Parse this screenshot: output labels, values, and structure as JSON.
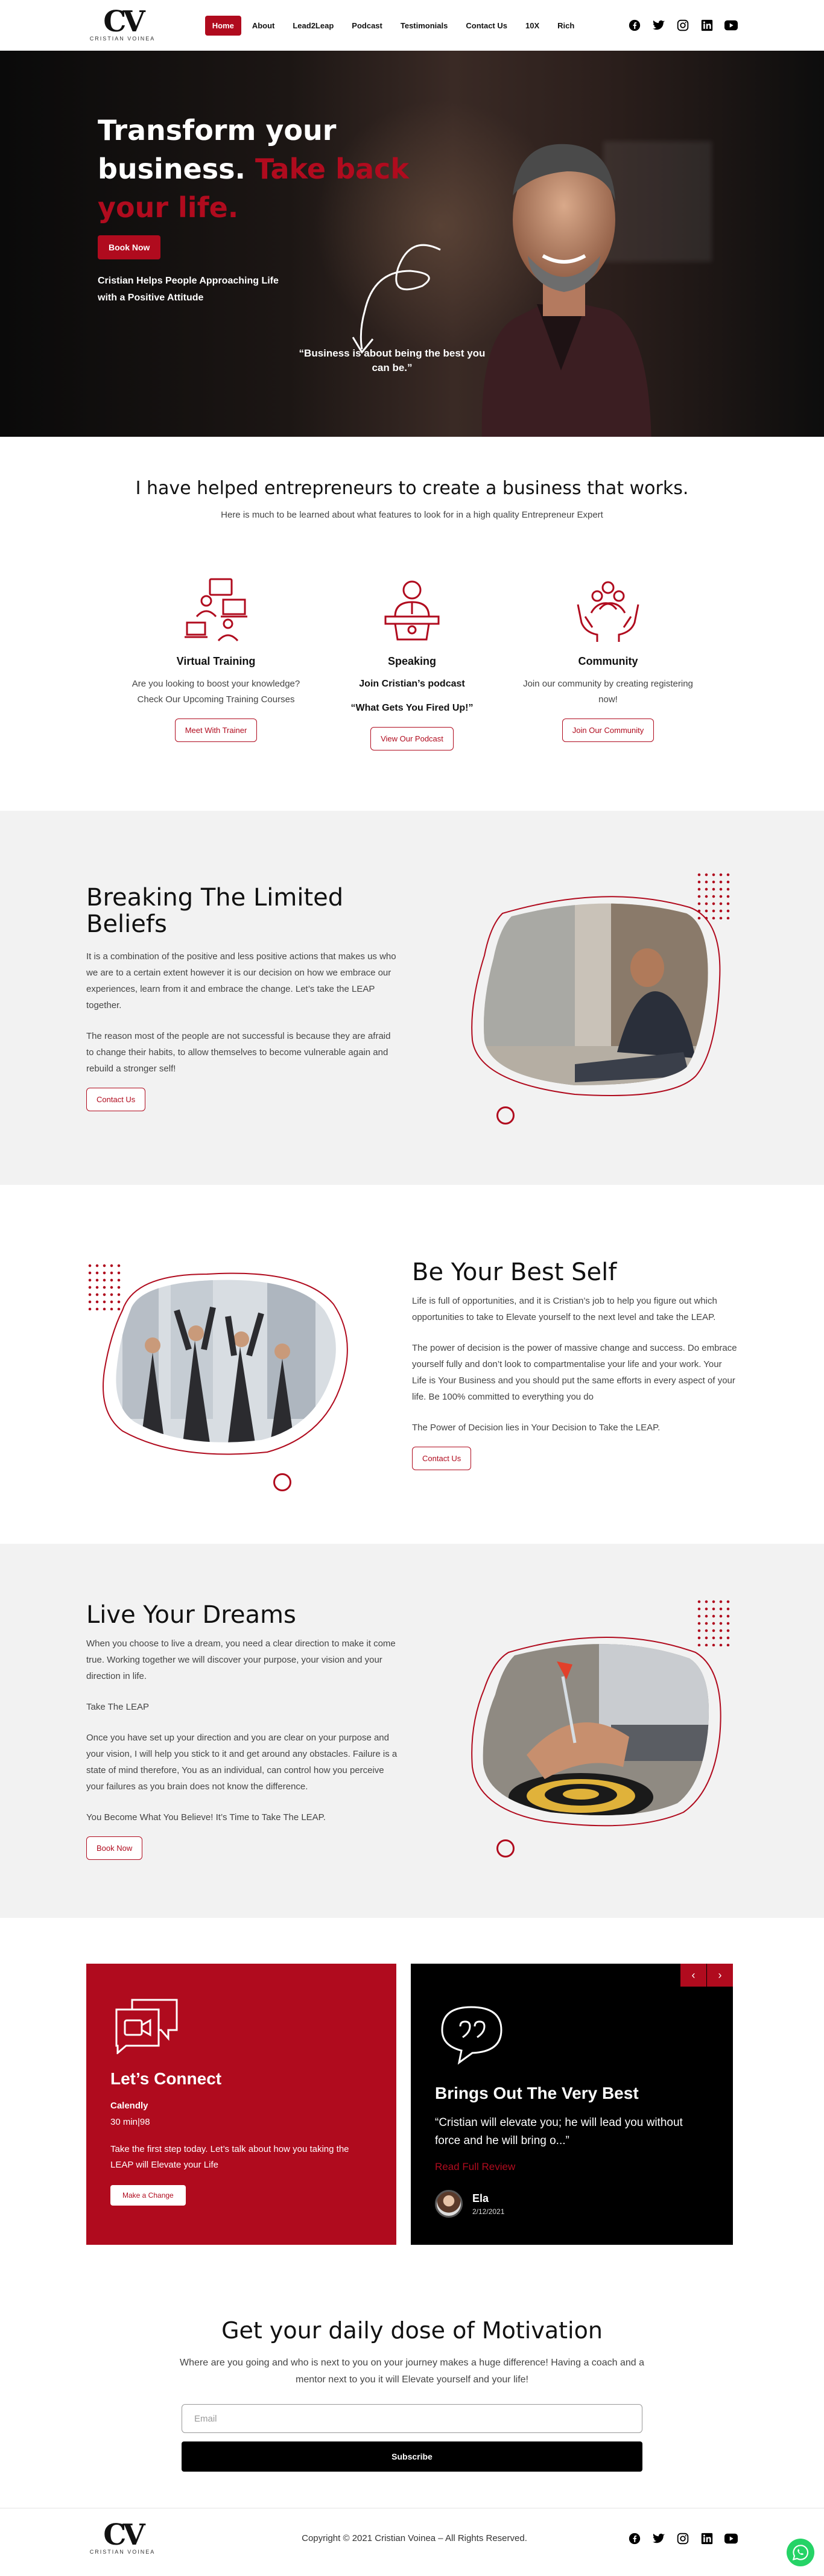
{
  "brand": {
    "logo_mark": "CV",
    "logo_text": "CRISTIAN VOINEA"
  },
  "nav": {
    "items": [
      {
        "label": "Home",
        "active": true
      },
      {
        "label": "About"
      },
      {
        "label": "Lead2Leap"
      },
      {
        "label": "Podcast"
      },
      {
        "label": "Testimonials"
      },
      {
        "label": "Contact Us"
      },
      {
        "label": "10X"
      },
      {
        "label": "Rich"
      }
    ]
  },
  "social": [
    "facebook-icon",
    "twitter-icon",
    "instagram-icon",
    "linkedin-icon",
    "youtube-icon"
  ],
  "hero": {
    "title_white": "Transform your business.",
    "title_red": "Take back your life.",
    "cta": "Book Now",
    "sub": "Cristian Helps People Approaching Life with a Positive Attitude",
    "quote": "“Business is about being the best you can be.”"
  },
  "helped": {
    "title": "I have helped entrepreneurs to create a business that works.",
    "lead": "Here is much to be learned about what features to look for in a high quality Entrepreneur Expert",
    "features": [
      {
        "title": "Virtual Training",
        "text": "Are you looking to boost your knowledge?",
        "text2": "Check Our Upcoming Training Courses",
        "button": "Meet With Trainer",
        "icon": "training-icon"
      },
      {
        "title": "Speaking",
        "text": "Join Cristian’s podcast",
        "text2": "“What Gets You Fired Up!”",
        "button": "View Our Podcast",
        "icon": "speaker-icon"
      },
      {
        "title": "Community",
        "text": "Join our community by creating registering now!",
        "text2": "",
        "button": "Join Our Community",
        "icon": "community-icon"
      }
    ]
  },
  "limited": {
    "title": "Breaking The Limited Beliefs",
    "p1": "It is a combination of the positive and less positive actions that makes us who we are to a certain extent however it is our decision on how we embrace our experiences, learn from it and embrace the change. Let’s take the LEAP together.",
    "p2": "The reason most of the people are not successful is because they are afraid to change their habits, to allow themselves to become vulnerable again and rebuild a stronger self!",
    "button": "Contact Us"
  },
  "best": {
    "title": "Be Your Best Self",
    "p1": "Life is full of opportunities, and it is Cristian’s job to help you figure out which opportunities to take to Elevate yourself to the next level and take the LEAP.",
    "p2": "The power of decision is the power of massive change and success. Do embrace yourself fully and don’t look to compartmentalise your life and your work. Your Life is Your Business and you should put the same efforts in every aspect of your life. Be 100% committed to everything you do",
    "p3": "The Power of Decision lies in Your Decision to Take the LEAP.",
    "button": "Contact Us"
  },
  "dreams": {
    "title": "Live Your Dreams",
    "p1": "When you choose to live a dream, you need a clear direction to make it come true. Working together we will discover your purpose, your vision and your direction in life.",
    "p2": "Take The LEAP",
    "p3": "Once you have set up your direction and you are clear on your purpose and your vision, I will help you stick to it and get around any obstacles. Failure is a state of mind therefore, You as an individual, can control how you perceive your failures as you brain does not know the difference.",
    "p4": "You Become What You Believe! It’s Time to Take The LEAP.",
    "button": "Book Now"
  },
  "connect": {
    "title": "Let’s Connect",
    "calendly": "Calendly",
    "duration": "30 min|98",
    "desc": "Take the first step today. Let’s talk about how you taking the LEAP will Elevate your Life",
    "button": "Make a Change",
    "testimonial_title": "Brings Out The Very Best",
    "testimonial_quote": "“Cristian will elevate you; he will lead you without force and he will bring o...”",
    "read_more": "Read Full Review",
    "reviewer": "Ela",
    "date": "2/12/2021",
    "prev": "‹",
    "next": "›"
  },
  "motivation": {
    "title": "Get your daily dose of Motivation",
    "text": "Where are you going and who is next to you on your journey makes a huge difference! Having a coach and a mentor next to you it will Elevate yourself and your life!",
    "email_placeholder": "Email",
    "button": "Subscribe"
  },
  "footer": {
    "copyright": "Copyright © 2021 Cristian Voinea – All Rights Reserved."
  },
  "colors": {
    "accent": "#b00b1e"
  }
}
